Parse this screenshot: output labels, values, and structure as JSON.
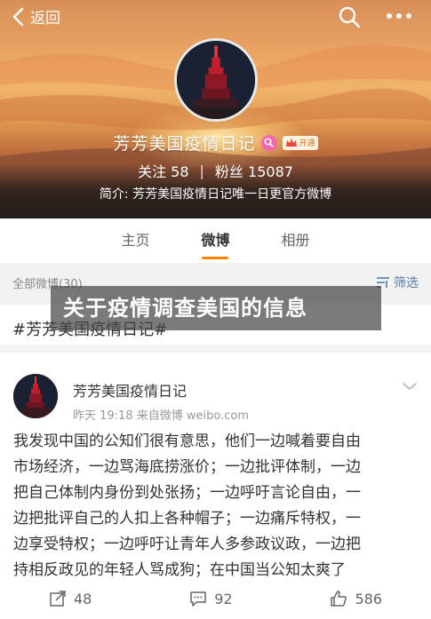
{
  "topbar": {
    "back_label": "返回",
    "back_icon": "chevron-left-icon",
    "search_icon": "search-icon",
    "more_icon": "more-dots-icon"
  },
  "profile": {
    "name": "芳芳美国疫情日记",
    "vip_label": "开通",
    "following_label": "关注",
    "following_count": "58",
    "separator": "|",
    "followers_label": "粉丝",
    "followers_count": "15087",
    "bio": "简介: 芳芳美国疫情日记唯一日更官方微博"
  },
  "tabs": [
    {
      "label": "主页",
      "active": false
    },
    {
      "label": "微博",
      "active": true
    },
    {
      "label": "相册",
      "active": false
    }
  ],
  "filter": {
    "all_posts_label": "全部微博(30)",
    "filter_label": "筛选"
  },
  "overlay": {
    "title": "关于疫情调查美国的信息"
  },
  "hashtag": "#芳芳美国疫情日记#",
  "post": {
    "author": "芳芳美国疫情日记",
    "meta": "昨天 19:18  来自微博 weibo.com",
    "body_lines": [
      "我发现中国的公知们很有意思，他们一边喊着要自由",
      "市场经济，一边骂海底捞涨价；一边批评体制，一边",
      "把自己体制内身份到处张扬；一边呼吁言论自由，一",
      "边把批评自己的人扣上各种帽子；一边痛斥特权，一",
      "边享受特权；一边呼吁让青年人多参政议政，一边把",
      "持相反政见的年轻人骂成狗；在中国当公知太爽了"
    ],
    "repost_count": "48",
    "comment_count": "92",
    "like_count": "586"
  },
  "colors": {
    "accent": "#ff8200",
    "link": "#507daf",
    "badge_pink": "#f06ab0"
  }
}
